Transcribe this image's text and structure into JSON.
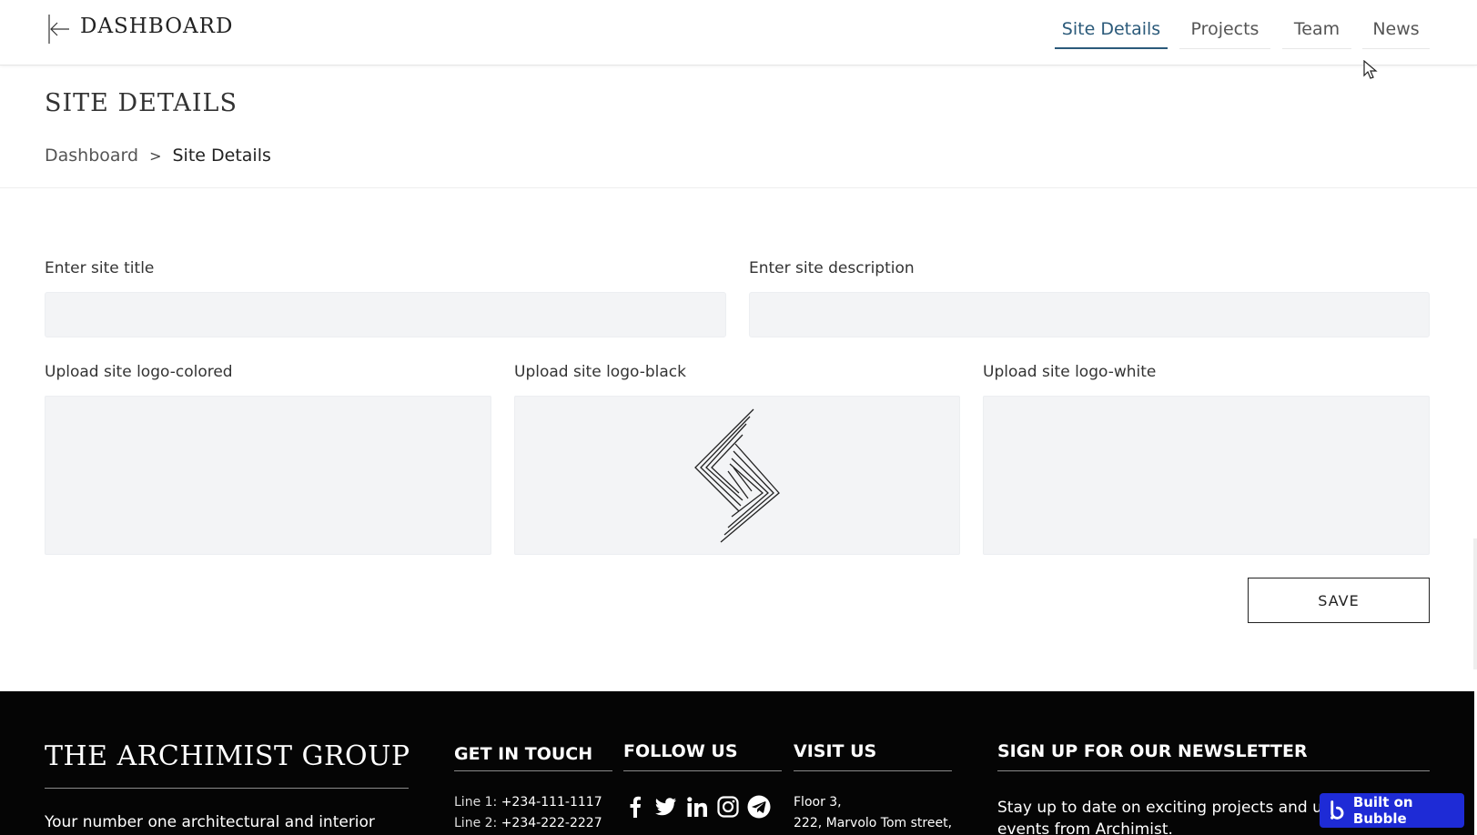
{
  "header": {
    "title": "DASHBOARD",
    "nav": [
      {
        "label": "Site Details",
        "active": true
      },
      {
        "label": "Projects",
        "active": false
      },
      {
        "label": "Team",
        "active": false
      },
      {
        "label": "News",
        "active": false
      }
    ]
  },
  "page": {
    "title": "SITE DETAILS",
    "breadcrumb": {
      "parent": "Dashboard",
      "separator": ">",
      "current": "Site Details"
    }
  },
  "form": {
    "site_title": {
      "label": "Enter site  title",
      "value": ""
    },
    "site_description": {
      "label": "Enter site  description",
      "value": ""
    },
    "logo_colored": {
      "label": "Upload site logo-colored"
    },
    "logo_black": {
      "label": "Upload site logo-black"
    },
    "logo_white": {
      "label": "Upload site logo-white"
    },
    "save_label": "SAVE"
  },
  "footer": {
    "brand": "THE ARCHIMIST GROUP",
    "tagline": "Your number one architectural and interior",
    "contact": {
      "heading": "GET IN TOUCH",
      "line1_label": "Line 1:",
      "line1_value": "+234-111-1117",
      "line2_label": "Line 2:",
      "line2_value": "+234-222-2227"
    },
    "follow": {
      "heading": "FOLLOW US",
      "icons": [
        "facebook-icon",
        "twitter-icon",
        "linkedin-icon",
        "instagram-icon",
        "telegram-icon"
      ]
    },
    "visit": {
      "heading": "VISIT US",
      "address_line1": "Floor 3,",
      "address_line2": "222, Marvolo Tom street,"
    },
    "newsletter": {
      "heading": "SIGN UP FOR OUR NEWSLETTER",
      "text_line1": "Stay up to date on exciting projects and up",
      "text_line2": "events from Archimist."
    }
  },
  "badge": {
    "label": "Built on Bubble"
  },
  "colors": {
    "accent": "#2b5a7a",
    "field_bg": "#f3f4f6",
    "footer_bg": "#050505",
    "bubble_blue": "#1e2bd6"
  }
}
